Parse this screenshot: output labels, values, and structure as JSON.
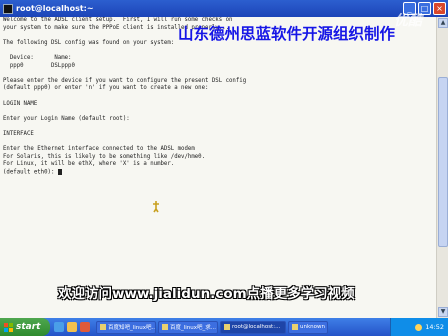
{
  "window": {
    "title": "root@localhost:~",
    "buttons": {
      "minimize": "_",
      "maximize": "□",
      "close": "×"
    }
  },
  "terminal": {
    "lines": [
      "Welcome to the ADSL client setup.  First, I will run some checks on",
      "your system to make sure the PPPoE client is installed properly...",
      "",
      "The following DSL config was found on your system:",
      "",
      "  Device:      Name:",
      "  ppp0        DSLppp0",
      "",
      "Please enter the device if you want to configure the present DSL config",
      "(default ppp0) or enter 'n' if you want to create a new one:",
      "",
      "LOGIN NAME",
      "",
      "Enter your Login Name (default root):",
      "",
      "INTERFACE",
      "",
      "Enter the Ethernet interface connected to the ADSL modem",
      "For Solaris, this is likely to be something like /dev/hme0.",
      "For Linux, it will be ethX, where 'X' is a number.",
      "(default eth0):"
    ]
  },
  "overlay": {
    "top_caption": "山东德州思蓝软件开源组织制作",
    "bottom_caption": "欢迎访问www.jialidun.com点播更多学习视频",
    "watermark": "优酷"
  },
  "taskbar": {
    "start_label": "start",
    "buttons": [
      {
        "label": "百度知吧_linux吧...",
        "active": false
      },
      {
        "label": "百度_linux吧_求...",
        "active": false
      },
      {
        "label": "root@localhost:...",
        "active": true
      },
      {
        "label": "unknown",
        "active": false
      }
    ],
    "clock": "14:52"
  }
}
